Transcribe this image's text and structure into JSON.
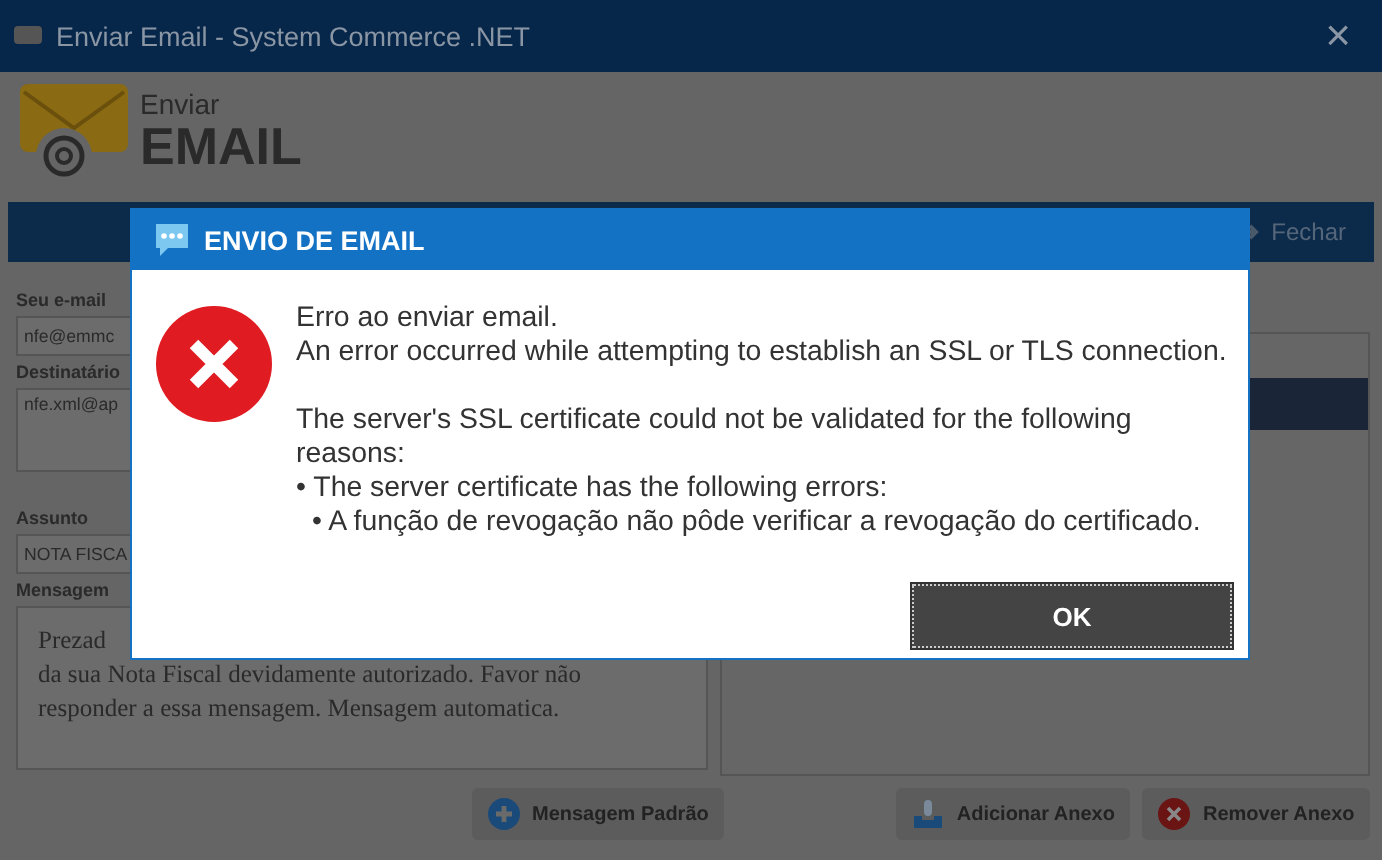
{
  "window": {
    "title": "Enviar Email - System Commerce .NET",
    "close": "×"
  },
  "header": {
    "subtitle": "Enviar",
    "title": "EMAIL"
  },
  "toolbar": {
    "close_label": "Fechar"
  },
  "form": {
    "fields": [
      {
        "label": "Seu e-mail",
        "value": "nfe@emmc",
        "kind": "line"
      },
      {
        "label": "Destinatário",
        "value": "nfe.xml@ap",
        "kind": "area"
      },
      {
        "label": "Assunto",
        "value": "NOTA FISCA",
        "kind": "line"
      }
    ],
    "message": {
      "label": "Mensagem",
      "lines": [
        "Prezad",
        "da sua Nota Fiscal devidamente autorizado. Favor não",
        "responder a essa mensagem. Mensagem automatica."
      ]
    }
  },
  "buttons": [
    {
      "label": "Mensagem Padrão",
      "kind": "add"
    },
    {
      "label": "Adicionar Anexo",
      "kind": "attach"
    },
    {
      "label": "Remover Anexo",
      "kind": "remove"
    }
  ],
  "dialog": {
    "title": "ENVIO DE EMAIL",
    "paragraphs": [
      {
        "lines": [
          {
            "text": "Erro ao enviar email."
          },
          {
            "text": "An error occurred while attempting to establish an SSL or TLS connection."
          }
        ]
      },
      {
        "lines": [
          {
            "text": "The server's SSL certificate could not be validated for the following reasons:",
            "children": [
              {
                "text": "• The server certificate has the following errors:",
                "children": [
                  {
                    "text": "• A função de revogação não pôde verificar a revogação do certificado."
                  }
                ]
              }
            ]
          }
        ]
      }
    ],
    "ok": "OK"
  }
}
